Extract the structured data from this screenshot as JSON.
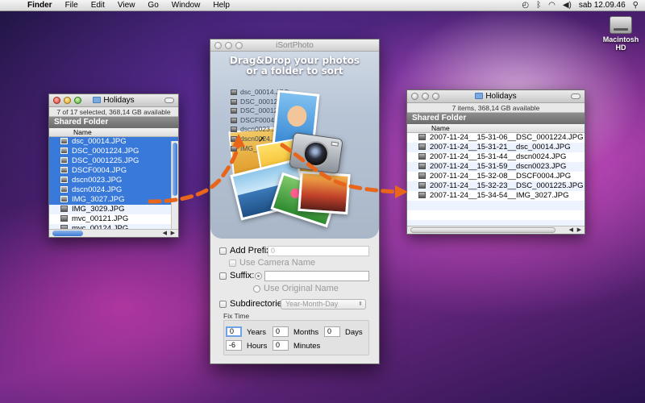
{
  "menubar": {
    "apple": "",
    "items": [
      "Finder",
      "File",
      "Edit",
      "View",
      "Go",
      "Window",
      "Help"
    ],
    "clock": "sab 12.09.46",
    "status_icons": [
      "time-machine-icon",
      "bluetooth-icon",
      "wifi-icon",
      "volume-icon",
      "spotlight-icon"
    ]
  },
  "desktop": {
    "hd_label_1": "Macintosh",
    "hd_label_2": "HD"
  },
  "left_window": {
    "title": "Holidays",
    "status": "7 of 17 selected, 368,14 GB available",
    "section": "Shared Folder",
    "column": "Name",
    "files": [
      {
        "name": "dsc_00014.JPG",
        "selected": true
      },
      {
        "name": "DSC_0001224.JPG",
        "selected": true
      },
      {
        "name": "DSC_0001225.JPG",
        "selected": true
      },
      {
        "name": "DSCF0004.JPG",
        "selected": true
      },
      {
        "name": "dscn0023.JPG",
        "selected": true
      },
      {
        "name": "dscn0024.JPG",
        "selected": true
      },
      {
        "name": "IMG_3027.JPG",
        "selected": true
      },
      {
        "name": "IMG_3029.JPG",
        "selected": false
      },
      {
        "name": "mvc_00121.JPG",
        "selected": false
      },
      {
        "name": "mvc_00124.JPG",
        "selected": false
      }
    ]
  },
  "right_window": {
    "title": "Holidays",
    "status": "7 items, 368,14 GB available",
    "section": "Shared Folder",
    "column": "Name",
    "files": [
      "2007-11-24__15-31-06__DSC_0001224.JPG",
      "2007-11-24__15-31-21__dsc_00014.JPG",
      "2007-11-24__15-31-44__dscn0024.JPG",
      "2007-11-24__15-31-59__dscn0023.JPG",
      "2007-11-24__15-32-08__DSCF0004.JPG",
      "2007-11-24__15-32-23__DSC_0001225.JPG",
      "2007-11-24__15-34-54__IMG_3027.JPG"
    ]
  },
  "app": {
    "title": "iSortPhoto",
    "drop_line1": "Drag&Drop your photos",
    "drop_line2": "or a folder to sort",
    "stack_files": [
      "dsc_00014.JPG",
      "DSC_0001224...",
      "DSC_0001225...",
      "DSCF0004.JPG",
      "dscn0023.JPG",
      "dscn0024.JPG",
      "IMG_3027.JPG"
    ],
    "add_prefix_label": "Add Prefix:",
    "prefix_value": "0",
    "use_camera_name": "Use Camera Name",
    "suffix_label": "Suffix:",
    "use_original_name": "Use Original Name",
    "subdirectories_label": "Subdirectories:",
    "subdir_option": "Year-Month-Day",
    "fix_time_label": "Fix Time",
    "years_label": "Years",
    "years_value": "0",
    "months_label": "Months",
    "months_value": "0",
    "days_label": "Days",
    "days_value": "0",
    "hours_label": "Hours",
    "hours_value": "-6",
    "minutes_label": "Minutes",
    "minutes_value": "0"
  },
  "colors": {
    "selection": "#3879d9",
    "arrow": "#e8661c"
  }
}
